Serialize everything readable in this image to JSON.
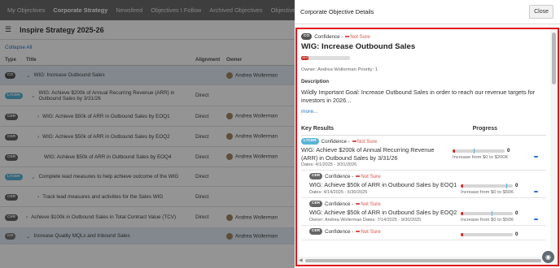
{
  "nav": {
    "tabs": [
      "My Objectives",
      "Corporate Strategy",
      "Newsfeed",
      "Objectives I Follow",
      "Archived Objectives",
      "Objective L"
    ]
  },
  "strategy": {
    "title": "Inspire Strategy 2025-26",
    "collapse_all": "Collapse All"
  },
  "table": {
    "headers": [
      "Type",
      "Title",
      "Alignment",
      "Owner"
    ],
    "rows": [
      {
        "type": "CO",
        "title": "WIG: Increase Outbound Sales",
        "alignment": "",
        "owner": "Andrea Wollerman"
      },
      {
        "type": "LTCER",
        "title": "WIG: Achieve $200k of Annual Recurring Revenue (ARR) in Outbound Sales by 3/31/26",
        "alignment": "Direct",
        "owner": ""
      },
      {
        "type": "CER",
        "title": "WIG: Achieve $50k of ARR in Outbound Sales by EOQ1",
        "alignment": "Direct",
        "owner": "Andrea Wollerman"
      },
      {
        "type": "CER",
        "title": "WIG: Achieve $50k of ARR in Outbound Sales by EOQ2",
        "alignment": "Direct",
        "owner": "Andrea Wollerman"
      },
      {
        "type": "CER",
        "title": "WIG: Achieve $50k of ARR in Outbound Sales by EOQ4",
        "alignment": "Direct",
        "owner": "Andrea Wollerman"
      },
      {
        "type": "LTCER",
        "title": "Complete lead measures to help achieve outcome of the WIG",
        "alignment": "Direct",
        "owner": ""
      },
      {
        "type": "CER",
        "title": "Track lead measures and activities for the Sales WIG",
        "alignment": "Direct",
        "owner": ""
      },
      {
        "type": "CER",
        "title": "Achieve $100k in Outbound Sales in Total Contract Value (TCV)",
        "alignment": "Direct",
        "owner": "Andrea Wollerman"
      },
      {
        "type": "CO",
        "title": "Increase Quality MQLs and Inbound Sales",
        "alignment": "",
        "owner": "Andrea Wollerman"
      }
    ]
  },
  "panel": {
    "title": "Corporate Objective Details",
    "close": "Close",
    "objective": {
      "type": "CO",
      "confidence_label": "Confidence -",
      "confidence_value": "Not Sure",
      "title": "WIG: Increase Outbound Sales",
      "progress_label": "15.0",
      "progress_fraction": 0.15,
      "owner_line": "Owner: Andrea Wollerman  Priority: 1",
      "description_label": "Description",
      "description": "Wildly Important Goal: Increase Outbound Sales in order to reach our revenue targets for investors in 2026...",
      "more": "more..."
    },
    "key_results_label": "Key Results",
    "progress_label": "Progress",
    "key_results": [
      {
        "type": "LTCER",
        "confidence": "Confidence -",
        "status": "Not Sure",
        "title": "WIG: Achieve $200k of Annual Recurring Revenue (ARR) in Outbound Sales by 3/31/26",
        "dates": "Dates: 4/1/2025 - 3/31/2026",
        "value": "0",
        "range": "Increase from $0 to $200K"
      },
      {
        "type": "CER",
        "confidence": "Confidence -",
        "status": "Not Sure",
        "title": "WIG: Achieve $50k of ARR in Outbound Sales by EOQ1",
        "dates": "Dates: 4/14/2025 - 6/30/2025",
        "value": "0",
        "range": "Increase from $0 to $50K"
      },
      {
        "type": "CER",
        "confidence": "Confidence -",
        "status": "Not Sure",
        "title": "WIG: Achieve $50k of ARR in Outbound Sales by EOQ2",
        "dates": "Owner: Andrea Wollerman  Dates: 7/14/2025 - 9/30/2025",
        "value": "0",
        "range": "Increase from $0 to $50K"
      },
      {
        "type": "CER",
        "confidence": "Confidence -",
        "status": "Not Sure",
        "title": "",
        "dates": "",
        "value": "0",
        "range": ""
      }
    ]
  },
  "colors": {
    "not_sure": "#d9534f",
    "highlight_border": "#e0191d",
    "link": "#2a73c9",
    "ltcer_badge": "#5ab3d6"
  }
}
